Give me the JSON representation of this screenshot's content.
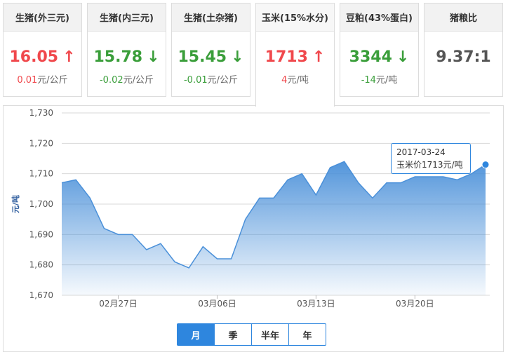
{
  "cards": [
    {
      "title": "生猪(外三元)",
      "price": "16.05",
      "direction": "up",
      "arrow": "↑",
      "change": "0.01",
      "unit": "元/公斤"
    },
    {
      "title": "生猪(内三元)",
      "price": "15.78",
      "direction": "down",
      "arrow": "↓",
      "change": "-0.02",
      "unit": "元/公斤"
    },
    {
      "title": "生猪(土杂猪)",
      "price": "15.45",
      "direction": "down",
      "arrow": "↓",
      "change": "-0.01",
      "unit": "元/公斤"
    },
    {
      "title": "玉米(15%水分)",
      "price": "1713",
      "direction": "up",
      "arrow": "↑",
      "change": "4",
      "unit": "元/吨"
    },
    {
      "title": "豆粕(43%蛋白)",
      "price": "3344",
      "direction": "down",
      "arrow": "↓",
      "change": "-14",
      "unit": "元/吨"
    },
    {
      "title": "猪粮比",
      "price": "9.37:1"
    }
  ],
  "colors": {
    "up": "#f0484c",
    "down": "#3a9e3a",
    "accent": "#2e86de",
    "series": "#4a90d9"
  },
  "range_buttons": [
    "月",
    "季",
    "半年",
    "年"
  ],
  "selected_range": "月",
  "tooltip": {
    "date": "2017-03-24",
    "label": "玉米价1713元/吨"
  },
  "chart_data": {
    "type": "area",
    "ylabel": "元/吨",
    "ylim": [
      1670,
      1730
    ],
    "yticks": [
      "1,670",
      "1,680",
      "1,690",
      "1,700",
      "1,710",
      "1,720",
      "1,730"
    ],
    "xticks": [
      "02月27日",
      "03月06日",
      "03月13日",
      "03月20日"
    ],
    "grid": true,
    "series": [
      {
        "values": [
          1707,
          1708,
          1702,
          1692,
          1690,
          1690,
          1685,
          1687,
          1681,
          1679,
          1686,
          1682,
          1682,
          1695,
          1702,
          1702,
          1708,
          1710,
          1703,
          1712,
          1714,
          1707,
          1702,
          1707,
          1707,
          1709,
          1709,
          1709,
          1708,
          1710,
          1713
        ]
      }
    ]
  }
}
